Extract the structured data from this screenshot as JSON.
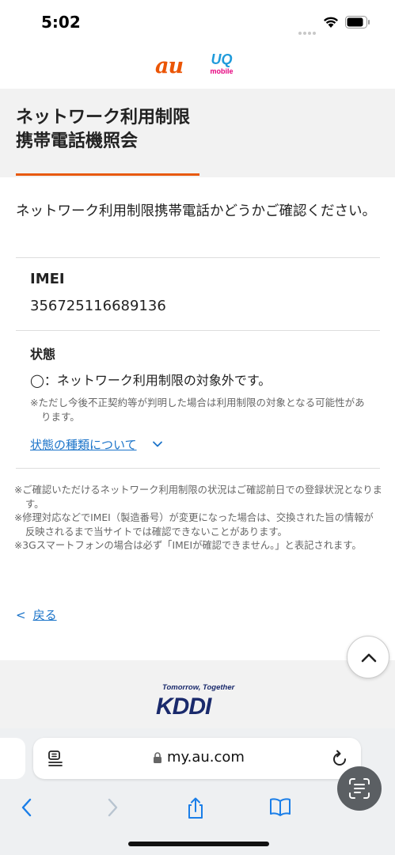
{
  "status_bar": {
    "time": "5:02"
  },
  "header": {
    "brand_au": "au",
    "brand_uq": "UQ",
    "brand_uq_sub": "mobile"
  },
  "title": {
    "line1": "ネットワーク利用制限",
    "line2": "携帯電話機照会"
  },
  "intro": "ネットワーク利用制限携帯電話かどうかご確認ください。",
  "imei": {
    "label": "IMEI",
    "value": "356725116689136"
  },
  "status": {
    "label": "状態",
    "result": "◯：ネットワーク利用制限の対象外です。",
    "note": "※ただし今後不正契約等が判明した場合は利用制限の対象となる可能性があります。",
    "types_link": "状態の種類について"
  },
  "footnotes": [
    "※ご確認いただけるネットワーク利用制限の状況はご確認前日での登録状況となります。",
    "※修理対応などでIMEI（製造番号）が変更になった場合は、交換された旨の情報が反映されるまで当サイトでは確認できないことがあります。",
    "※3Gスマートフォンの場合は必ず「IMEIが確認できません。」と表記されます。"
  ],
  "back_link": {
    "chevron": "<",
    "label": "戻る"
  },
  "footer": {
    "tagline": "Tomorrow, Together",
    "logo": "KDDI"
  },
  "browser": {
    "url": "my.au.com"
  },
  "colors": {
    "accent": "#e8590c",
    "link": "#1a73c9",
    "brand_au": "#eb5505",
    "brand_uq": "#1f9bdb",
    "kddi": "#1a2a6c"
  }
}
